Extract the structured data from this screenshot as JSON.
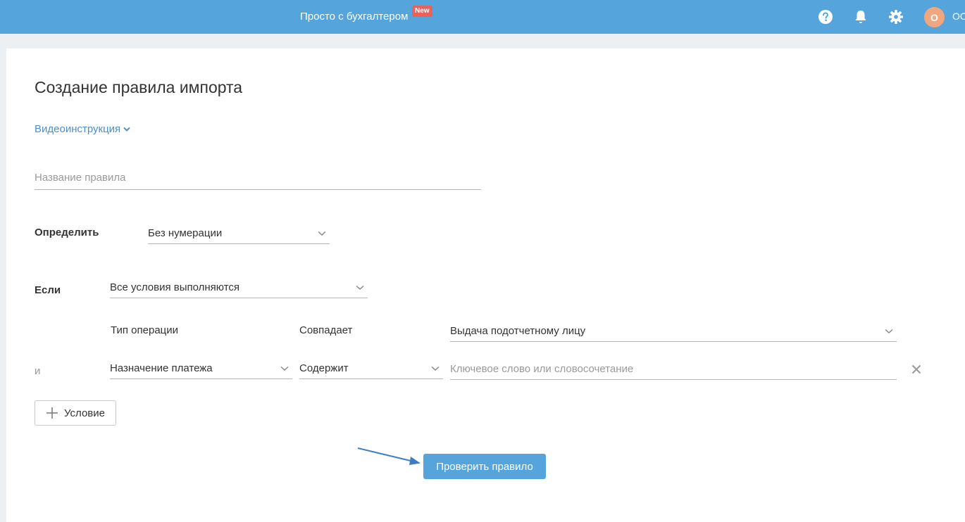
{
  "header": {
    "top_link": "Просто с бухгалтером",
    "new_badge": "New",
    "avatar_letter": "О",
    "user_short": "ОО",
    "icons": [
      "help-icon",
      "bell-icon",
      "gear-icon"
    ]
  },
  "page": {
    "title": "Создание правила импорта",
    "video_link": "Видеоинструкция"
  },
  "form": {
    "rule_name_placeholder": "Название правила",
    "determine_label": "Определить",
    "determine_value": "Без нумерации",
    "if_label": "Если",
    "if_value": "Все условия выполняются",
    "condition1": {
      "field": "Тип операции",
      "operator": "Совпадает",
      "value": "Выдача подотчетному лицу"
    },
    "and_label": "и",
    "condition2": {
      "field": "Назначение платежа",
      "operator": "Содержит",
      "value_placeholder": "Ключевое слово или словосочетание"
    },
    "add_condition_label": "Условие",
    "check_rule_label": "Проверить правило"
  },
  "colors": {
    "header_bg": "#55a5dc",
    "badge": "#e9615a",
    "avatar": "#f0a780",
    "link": "#4a90c9",
    "primary": "#55a5dc"
  }
}
